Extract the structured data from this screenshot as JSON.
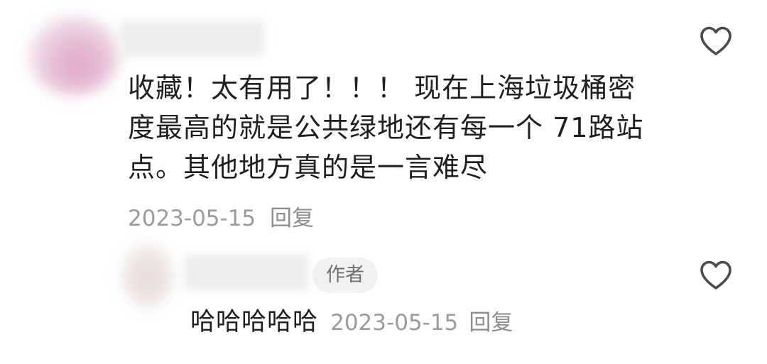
{
  "comment": {
    "text": "收藏！太有用了！！！ 现在上海垃圾桶密度最高的就是公共绿地还有每一个 71路站点。其他地方真的是一言难尽",
    "date": "2023-05-15",
    "reply_label": "回复",
    "like_icon": "heart-outline-icon"
  },
  "reply": {
    "author_badge": "作者",
    "text": "哈哈哈哈哈",
    "date": "2023-05-15",
    "reply_label": "回复",
    "like_icon": "heart-outline-icon"
  },
  "colors": {
    "text_primary": "#1f1f1f",
    "text_secondary": "#9b9b9b",
    "badge_bg": "#f1f1f1"
  }
}
